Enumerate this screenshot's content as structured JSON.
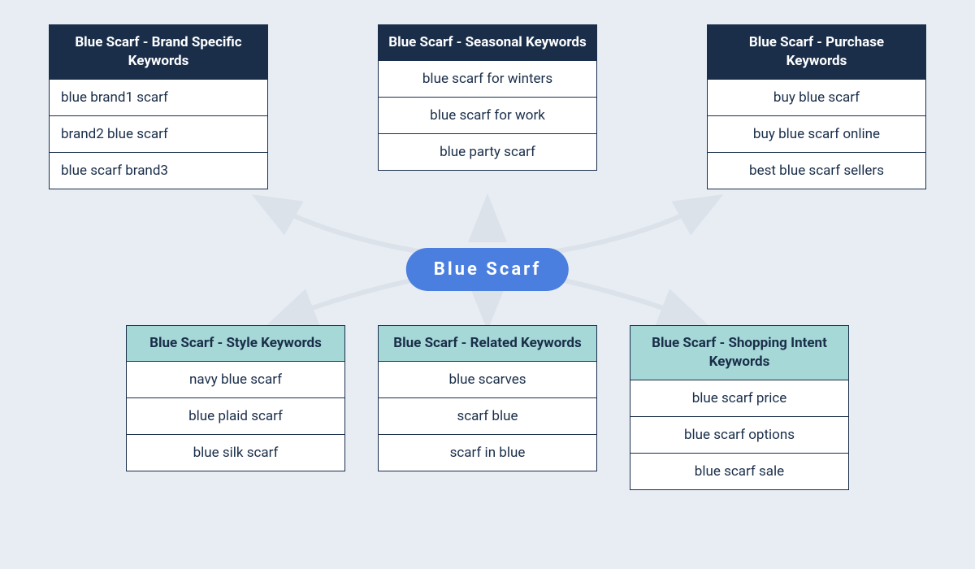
{
  "hub": {
    "label": "Blue Scarf"
  },
  "cards": {
    "brand": {
      "title": "Blue Scarf - Brand Specific Keywords",
      "headerStyle": "dark",
      "align": "left",
      "rows": [
        "blue brand1 scarf",
        "brand2 blue scarf",
        "blue scarf brand3"
      ]
    },
    "seasonal": {
      "title": "Blue Scarf - Seasonal Keywords",
      "headerStyle": "dark",
      "align": "center",
      "rows": [
        "blue scarf for winters",
        "blue scarf for work",
        "blue party scarf"
      ]
    },
    "purchase": {
      "title": "Blue Scarf - Purchase Keywords",
      "headerStyle": "dark",
      "align": "center",
      "rows": [
        "buy blue scarf",
        "buy blue scarf online",
        "best blue scarf sellers"
      ]
    },
    "style": {
      "title": "Blue Scarf - Style Keywords",
      "headerStyle": "teal",
      "align": "center",
      "rows": [
        "navy blue scarf",
        "blue plaid scarf",
        "blue silk scarf"
      ]
    },
    "related": {
      "title": "Blue Scarf - Related Keywords",
      "headerStyle": "teal",
      "align": "center",
      "rows": [
        "blue scarves",
        "scarf blue",
        "scarf in blue"
      ]
    },
    "shopping": {
      "title": "Blue Scarf -  Shopping Intent Keywords",
      "headerStyle": "teal",
      "align": "center",
      "rows": [
        "blue scarf price",
        "blue scarf options",
        "blue scarf sale"
      ]
    }
  },
  "colors": {
    "bg": "#e7edf3",
    "dark": "#1a2e4a",
    "teal": "#a5d8d6",
    "hub": "#4a7fe0",
    "arrow": "#dbe2e9"
  }
}
